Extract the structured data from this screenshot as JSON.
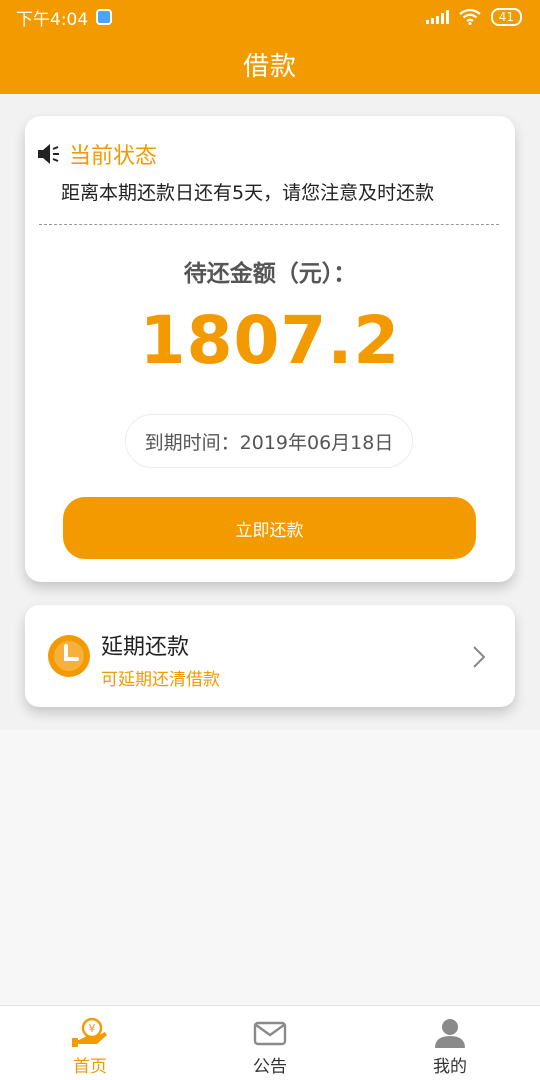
{
  "status_bar": {
    "time": "下午4:04",
    "battery": "41"
  },
  "header": {
    "title": "借款"
  },
  "status_card": {
    "title": "当前状态",
    "message": "距离本期还款日还有5天，请您注意及时还款",
    "amount_label": "待还金额（元）：",
    "amount_value": "1807.2",
    "due_date": "到期时间：2019年06月18日",
    "repay_button": "立即还款"
  },
  "defer_card": {
    "title": "延期还款",
    "subtitle": "可延期还清借款"
  },
  "tabs": [
    {
      "label": "首页",
      "icon": "hand-coin-icon",
      "active": true
    },
    {
      "label": "公告",
      "icon": "mail-icon",
      "active": false
    },
    {
      "label": "我的",
      "icon": "user-icon",
      "active": false
    }
  ],
  "colors": {
    "accent": "#f39a00"
  }
}
